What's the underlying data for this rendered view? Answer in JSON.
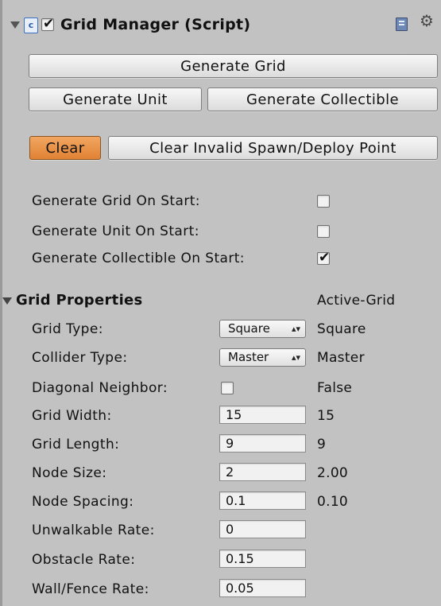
{
  "header": {
    "title": "Grid Manager (Script)",
    "enabled": true
  },
  "buttons": {
    "generate_grid": "Generate Grid",
    "generate_unit": "Generate Unit",
    "generate_collectible": "Generate Collectible",
    "clear": "Clear",
    "clear_invalid": "Clear Invalid Spawn/Deploy Point"
  },
  "toggles": [
    {
      "label": "Generate Grid On Start:",
      "checked": false
    },
    {
      "label": "Generate Unit On Start:",
      "checked": false
    },
    {
      "label": "Generate Collectible On Start:",
      "checked": true
    }
  ],
  "grid_properties": {
    "title": "Grid Properties",
    "active_label": "Active-Grid",
    "grid_type": {
      "label": "Grid Type:",
      "selected": "Square",
      "display": "Square",
      "value": "Square"
    },
    "collider_type": {
      "label": "Collider Type:",
      "selected": "Master",
      "value": "Master"
    },
    "diagonal_neighbor": {
      "label": "Diagonal Neighbor:",
      "checked": false,
      "value": "False"
    },
    "grid_width": {
      "label": "Grid Width:",
      "input": "15",
      "value": "15"
    },
    "grid_length": {
      "label": "Grid Length:",
      "input": "9",
      "value": "9"
    },
    "node_size": {
      "label": "Node Size:",
      "input": "2",
      "value": "2.00"
    },
    "node_spacing": {
      "label": "Node Spacing:",
      "input": "0.1",
      "value": "0.10"
    },
    "unwalkable_rate": {
      "label": "Unwalkable Rate:",
      "input": "0"
    },
    "obstacle_rate": {
      "label": "Obstacle Rate:",
      "input": "0.15"
    },
    "wall_fence_rate": {
      "label": "Wall/Fence Rate:",
      "input": "0.05"
    }
  },
  "icons": [
    "foldout-arrow-icon",
    "script-icon",
    "book-help-icon",
    "gear-icon"
  ],
  "colors": {
    "panel": "#c2c2c2",
    "clear_button": "#e8893c",
    "button": "#e8e8e8"
  }
}
